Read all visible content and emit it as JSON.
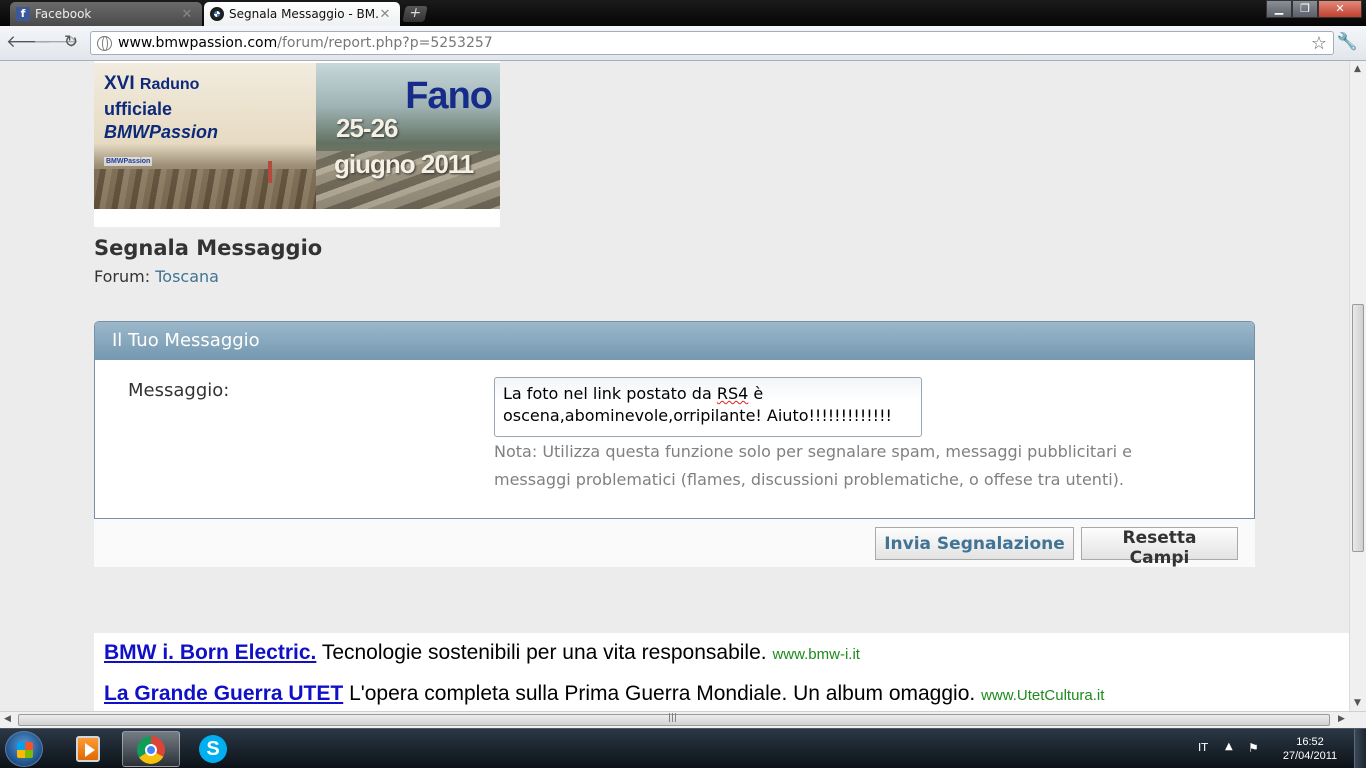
{
  "browser": {
    "tabs": [
      {
        "label": "Facebook"
      },
      {
        "label": "Segnala Messaggio - BM..."
      }
    ],
    "new_tab_label": "+",
    "url_host": "www.bmwpassion.com",
    "url_path": "/forum/report.php?p=5253257"
  },
  "banner": {
    "line1_big": "XVI",
    "line1_small": "Raduno",
    "line2": "ufficiale",
    "line3": "BMWPassion",
    "logo_text": "BMWPassion",
    "city": "Fano",
    "dates": "25-26",
    "month_year": "giugno 2011"
  },
  "page": {
    "title": "Segnala Messaggio",
    "forum_label": "Forum:",
    "forum_name": "Toscana"
  },
  "panel": {
    "header": "Il Tuo Messaggio",
    "message_label": "Messaggio:",
    "message_text_1": "La foto nel link postato da ",
    "message_text_misspelled": "RS4",
    "message_text_2": " è",
    "message_text_3": "oscena,abominevole,orripilante! Aiuto!!!!!!!!!!!!!",
    "note_line1": "Nota: Utilizza questa funzione solo per segnalare spam, messaggi pubblicitari e",
    "note_line2": "messaggi problematici (flames, discussioni problematiche, o offese tra utenti)."
  },
  "buttons": {
    "submit": "Invia Segnalazione",
    "reset": "Resetta Campi"
  },
  "ads": [
    {
      "title": "BMW i. Born Electric.",
      "text": " Tecnologie sostenibili per una vita responsabile. ",
      "domain": "www.bmw-i.it"
    },
    {
      "title": "La Grande Guerra UTET",
      "text": " L'opera completa sulla Prima Guerra Mondiale. Un album omaggio. ",
      "domain": "www.UtetCultura.it"
    }
  ],
  "taskbar": {
    "language": "IT",
    "time": "16:52",
    "date": "27/04/2011"
  },
  "colors": {
    "link_blue": "#417394",
    "panel_header": "#7398b0",
    "ad_link": "#1010c8",
    "ad_domain": "#1d8a1d"
  },
  "icons": {
    "facebook_tab": "facebook-favicon",
    "bmw_tab": "bmw-favicon",
    "back": "back-arrow-icon",
    "forward": "forward-arrow-icon",
    "reload": "reload-icon",
    "star": "star-icon",
    "wrench": "wrench-icon"
  }
}
